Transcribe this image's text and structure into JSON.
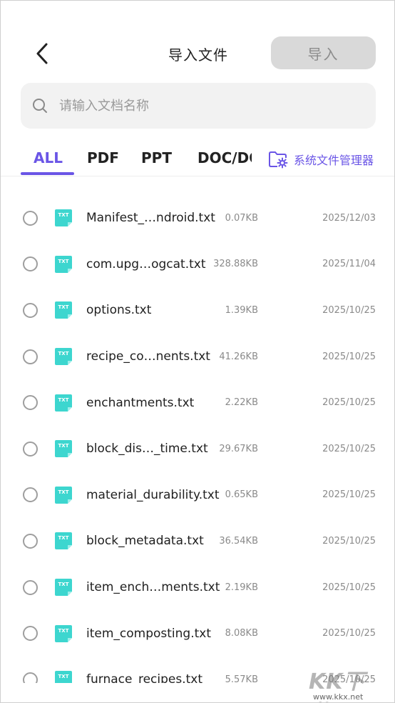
{
  "header": {
    "title": "导入文件",
    "import_label": "导入"
  },
  "search": {
    "placeholder": "请输入文档名称",
    "value": ""
  },
  "tabs": [
    {
      "label": "ALL",
      "active": true
    },
    {
      "label": "PDF",
      "active": false
    },
    {
      "label": "PPT",
      "active": false
    },
    {
      "label": "DOC/DOCX",
      "active": false
    }
  ],
  "file_manager": {
    "label": "系统文件管理器",
    "icon": "folder-gear-icon"
  },
  "accent_color": "#6a55e6",
  "file_icon_color": "#3dd6cf",
  "file_icon_label": "TXT",
  "files": [
    {
      "name": "Manifest_…ndroid.txt",
      "size": "0.07KB",
      "date": "2025/12/03"
    },
    {
      "name": "com.upg…ogcat.txt",
      "size": "328.88KB",
      "date": "2025/11/04"
    },
    {
      "name": "options.txt",
      "size": "1.39KB",
      "date": "2025/10/25"
    },
    {
      "name": "recipe_co…nents.txt",
      "size": "41.26KB",
      "date": "2025/10/25"
    },
    {
      "name": "enchantments.txt",
      "size": "2.22KB",
      "date": "2025/10/25"
    },
    {
      "name": "block_dis…_time.txt",
      "size": "29.67KB",
      "date": "2025/10/25"
    },
    {
      "name": "material_durability.txt",
      "size": "0.65KB",
      "date": "2025/10/25"
    },
    {
      "name": "block_metadata.txt",
      "size": "36.54KB",
      "date": "2025/10/25"
    },
    {
      "name": "item_ench…ments.txt",
      "size": "2.19KB",
      "date": "2025/10/25"
    },
    {
      "name": "item_composting.txt",
      "size": "8.08KB",
      "date": "2025/10/25"
    },
    {
      "name": "furnace_recipes.txt",
      "size": "5.57KB",
      "date": "2025/10/25"
    }
  ],
  "watermark": {
    "text": "KK下载",
    "url": "www.kkx.net"
  }
}
